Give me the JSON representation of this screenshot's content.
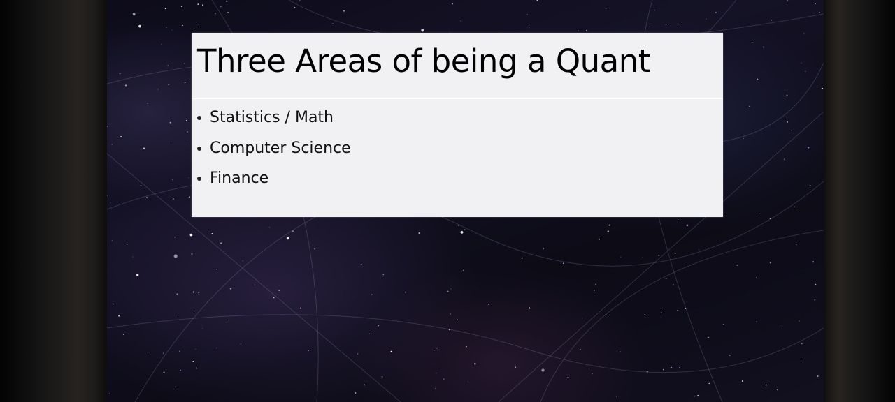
{
  "slide": {
    "title": "Three Areas of being a Quant",
    "bullets": [
      "Statistics / Math",
      "Computer Science",
      "Finance"
    ]
  },
  "colors": {
    "background": "#0d0c1a",
    "title_box": "#f1f0f3",
    "text": "#000000"
  }
}
